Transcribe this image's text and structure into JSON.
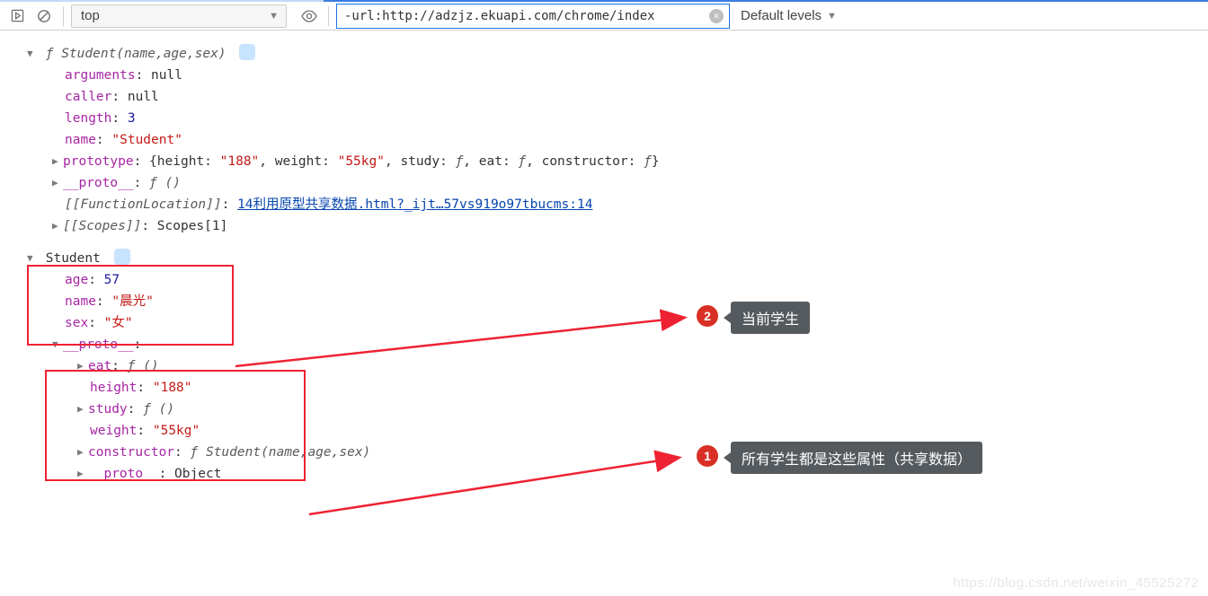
{
  "toolbar": {
    "context": "top",
    "filter_text": "-url:http://adzjz.ekuapi.com/chrome/index",
    "levels_label": "Default levels"
  },
  "fn": {
    "signature": "Student(name,age,sex)",
    "arguments": "null",
    "caller": "null",
    "length": "3",
    "name": "\"Student\"",
    "prototype_preview": "{height: \"188\", weight: \"55kg\", study: ƒ, eat: ƒ, constructor: ƒ}",
    "proto_preview": "ƒ ()",
    "location_label": "[[FunctionLocation]]",
    "location_link": "14利用原型共享数据.html?_ijt…57vs919o97tbucms:14",
    "scopes_label": "[[Scopes]]",
    "scopes_value": "Scopes[1]"
  },
  "instance": {
    "header": "Student",
    "age": "57",
    "name_val": "\"晨光\"",
    "sex": "\"女\"",
    "proto_header": "__proto__",
    "eat": "ƒ ()",
    "height": "\"188\"",
    "study": "ƒ ()",
    "weight": "\"55kg\"",
    "ctor": "ƒ Student(name,age,sex)",
    "proto_obj": "Object"
  },
  "annotations": {
    "badge1": "1",
    "badge2": "2",
    "label1": "所有学生都是这些属性（共享数据）",
    "label2": "当前学生"
  },
  "watermark": "https://blog.csdn.net/weixin_45525272"
}
